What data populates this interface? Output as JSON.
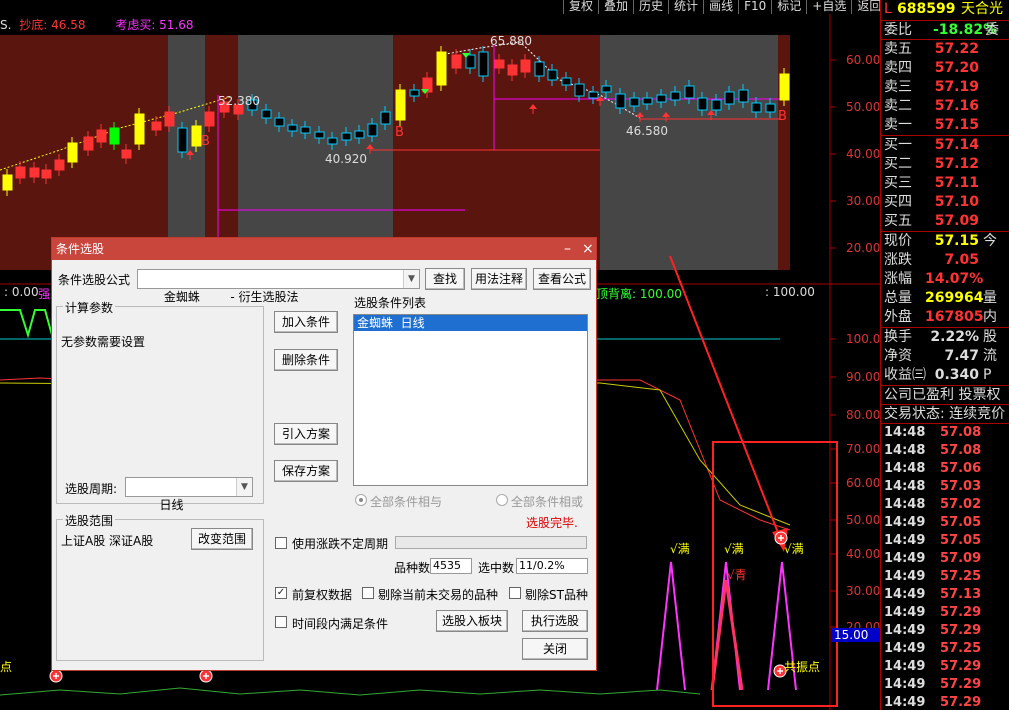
{
  "toolbar": [
    "复权",
    "叠加",
    "历史",
    "统计",
    "画线",
    "F10",
    "标记",
    "+自选",
    "返回"
  ],
  "top_labels": {
    "mode": "S.",
    "dibottom": "抄底: 46.58",
    "consider": "考虑买: 51.68"
  },
  "chart_annotations": {
    "high": "65.880",
    "p1": "52.380",
    "p2": "40.920",
    "p3": "46.580"
  },
  "price_axis": [
    "60.00",
    "50.00",
    "40.00",
    "30.00",
    "20.00"
  ],
  "indicator_header": {
    "left": ": 0.00",
    "strong": "强",
    "divergence": "顶背离: 100.00",
    "right": ": 100.00"
  },
  "indicator_axis": [
    "100.0",
    "90.00",
    "80.00",
    "70.00",
    "60.00",
    "50.00",
    "40.00",
    "30.00",
    "20.00"
  ],
  "indicator_labels": {
    "full1": "√满",
    "full2": "√满",
    "full3": "√满",
    "cyan": "√青",
    "resonance": "共振点",
    "left_point": "点",
    "current_value": "15.00"
  },
  "quote": {
    "code": "688599",
    "name": "天合光",
    "prefix": "L",
    "ratio_label": "委比",
    "ratio_value": "-18.82%",
    "ratio_extra": "委",
    "asks": [
      {
        "label": "卖五",
        "price": "57.22"
      },
      {
        "label": "卖四",
        "price": "57.20"
      },
      {
        "label": "卖三",
        "price": "57.19"
      },
      {
        "label": "卖二",
        "price": "57.16"
      },
      {
        "label": "卖一",
        "price": "57.15"
      }
    ],
    "bids": [
      {
        "label": "买一",
        "price": "57.14"
      },
      {
        "label": "买二",
        "price": "57.12"
      },
      {
        "label": "买三",
        "price": "57.11"
      },
      {
        "label": "买四",
        "price": "57.10"
      },
      {
        "label": "买五",
        "price": "57.09"
      }
    ],
    "stats": [
      {
        "label": "现价",
        "value": "57.15",
        "extra": "今",
        "color": "#ff0"
      },
      {
        "label": "涨跌",
        "value": "7.05",
        "extra": "",
        "color": "#f33"
      },
      {
        "label": "涨幅",
        "value": "14.07%",
        "extra": "",
        "color": "#f33"
      },
      {
        "label": "总量",
        "value": "269964",
        "extra": "量",
        "color": "#ff0"
      },
      {
        "label": "外盘",
        "value": "167805",
        "extra": "内",
        "color": "#f33"
      }
    ],
    "stats2": [
      {
        "label": "换手",
        "value": "2.22%",
        "extra": "股",
        "color": "#ddd"
      },
      {
        "label": "净资",
        "value": "7.47",
        "extra": "流",
        "color": "#ddd"
      },
      {
        "label": "收益㈢",
        "value": "0.340",
        "extra": "P",
        "color": "#ddd"
      }
    ],
    "profit": "公司已盈利 投票权",
    "status": "交易状态: 连续竞价",
    "ticks": [
      {
        "time": "14:48",
        "price": "57.08"
      },
      {
        "time": "14:48",
        "price": "57.08"
      },
      {
        "time": "14:48",
        "price": "57.06"
      },
      {
        "time": "14:48",
        "price": "57.03"
      },
      {
        "time": "14:48",
        "price": "57.02"
      },
      {
        "time": "14:49",
        "price": "57.05"
      },
      {
        "time": "14:49",
        "price": "57.05"
      },
      {
        "time": "14:49",
        "price": "57.09"
      },
      {
        "time": "14:49",
        "price": "57.25"
      },
      {
        "time": "14:49",
        "price": "57.13"
      },
      {
        "time": "14:49",
        "price": "57.29"
      },
      {
        "time": "14:49",
        "price": "57.29"
      },
      {
        "time": "14:49",
        "price": "57.25"
      },
      {
        "time": "14:49",
        "price": "57.29"
      },
      {
        "time": "14:49",
        "price": "57.29"
      },
      {
        "time": "14:49",
        "price": "57.29"
      }
    ]
  },
  "dialog": {
    "title": "条件选股",
    "formula_label": "条件选股公式",
    "formula_value": "金蜘蛛        - 衍生选股法",
    "find": "查找",
    "usage": "用法注释",
    "view": "查看公式",
    "params_title": "计算参数",
    "params_text": "无参数需要设置",
    "period_label": "选股周期:",
    "period_value": "日线",
    "range_title": "选股范围",
    "range_text": "上证A股  深证A股",
    "change_range": "改变范围",
    "add_cond": "加入条件",
    "del_cond": "删除条件",
    "import_plan": "引入方案",
    "save_plan": "保存方案",
    "list_title": "选股条件列表",
    "list_item": "金蜘蛛  日线",
    "all_and": "全部条件相与",
    "all_or": "全部条件相或",
    "done": "选股完毕.",
    "use_irregular": "使用涨跌不定周期",
    "count_label": "品种数",
    "count_value": "4535",
    "selected_label": "选中数",
    "selected_value": "11/0.2%",
    "forward_adj": "前复权数据",
    "exclude_untraded": "剔除当前未交易的品种",
    "exclude_st": "剔除ST品种",
    "time_range": "时间段内满足条件",
    "to_block": "选股入板块",
    "execute": "执行选股",
    "close": "关闭"
  }
}
